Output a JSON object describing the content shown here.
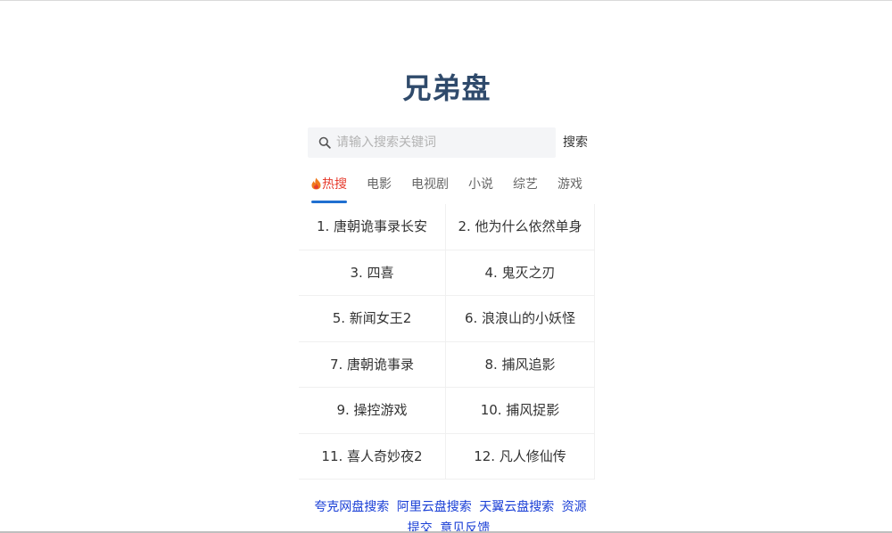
{
  "site": {
    "title": "兄弟盘"
  },
  "search": {
    "placeholder": "请输入搜索关键词",
    "value": "",
    "button_label": "搜索"
  },
  "tabs": [
    {
      "label": "热搜",
      "active": true
    },
    {
      "label": "电影",
      "active": false
    },
    {
      "label": "电视剧",
      "active": false
    },
    {
      "label": "小说",
      "active": false
    },
    {
      "label": "综艺",
      "active": false
    },
    {
      "label": "游戏",
      "active": false
    }
  ],
  "hot_list": [
    "1. 唐朝诡事录长安",
    "2. 他为什么依然单身",
    "3. 四喜",
    "4. 鬼灭之刃",
    "5. 新闻女王2",
    "6. 浪浪山的小妖怪",
    "7. 唐朝诡事录",
    "8. 捕风追影",
    "9. 操控游戏",
    "10. 捕风捉影",
    "11. 喜人奇妙夜2",
    "12. 凡人修仙传"
  ],
  "footer_links": [
    "夸克网盘搜索",
    "阿里云盘搜索",
    "天翼云盘搜索",
    "资源提交",
    "意见反馈"
  ],
  "colors": {
    "title": "#2f4a6b",
    "active_tab": "#e63c2e",
    "tab_indicator": "#1f6fd0",
    "link": "#1a3fd6"
  },
  "icons": {
    "search": "search-icon",
    "hot": "fire-icon"
  }
}
